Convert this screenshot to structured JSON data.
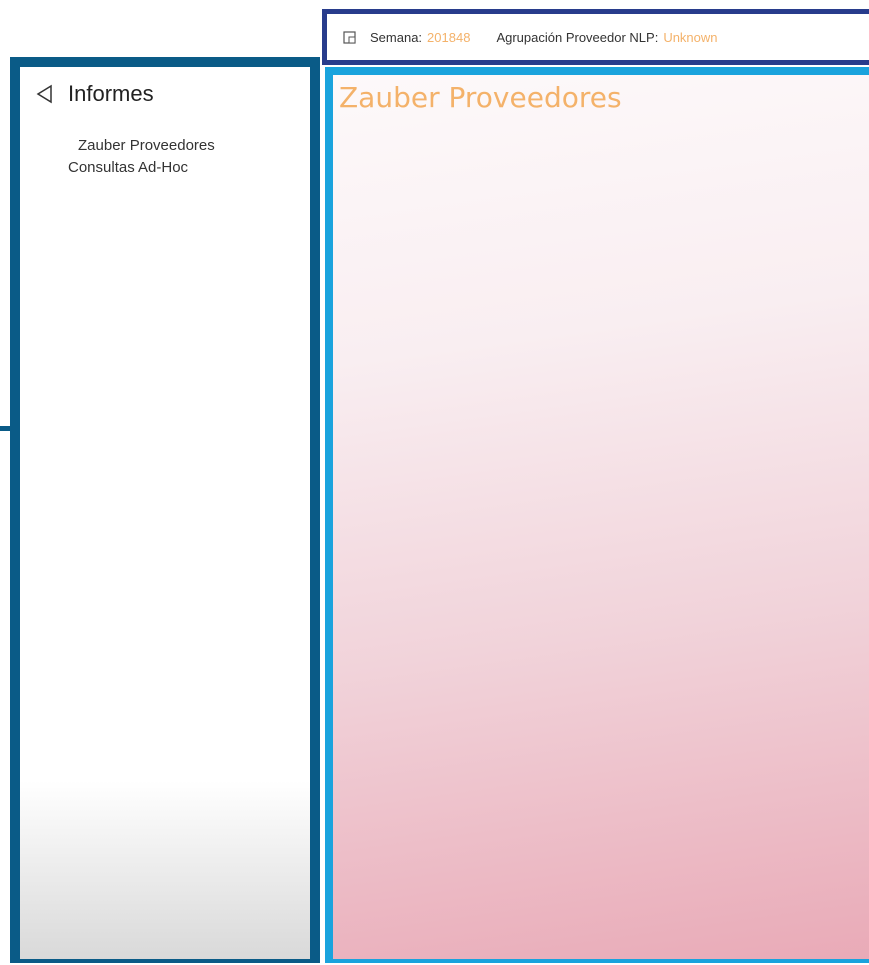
{
  "sidebar": {
    "title": "Informes",
    "items": [
      {
        "label": "Zauber Proveedores"
      },
      {
        "label": "Consultas Ad-Hoc"
      }
    ]
  },
  "filters": [
    {
      "label": "Semana:",
      "value": "201848"
    },
    {
      "label": "Agrupación Proveedor NLP:",
      "value": "Unknown"
    }
  ],
  "main": {
    "title": "Zauber Proveedores"
  },
  "colors": {
    "sidebar_border": "#0a5b87",
    "filter_border": "#283c8c",
    "main_border": "#1aa3dd",
    "accent_text": "#f4b26a"
  },
  "icons": {
    "collapse": "triangle-left-icon",
    "filter": "square-icon"
  }
}
